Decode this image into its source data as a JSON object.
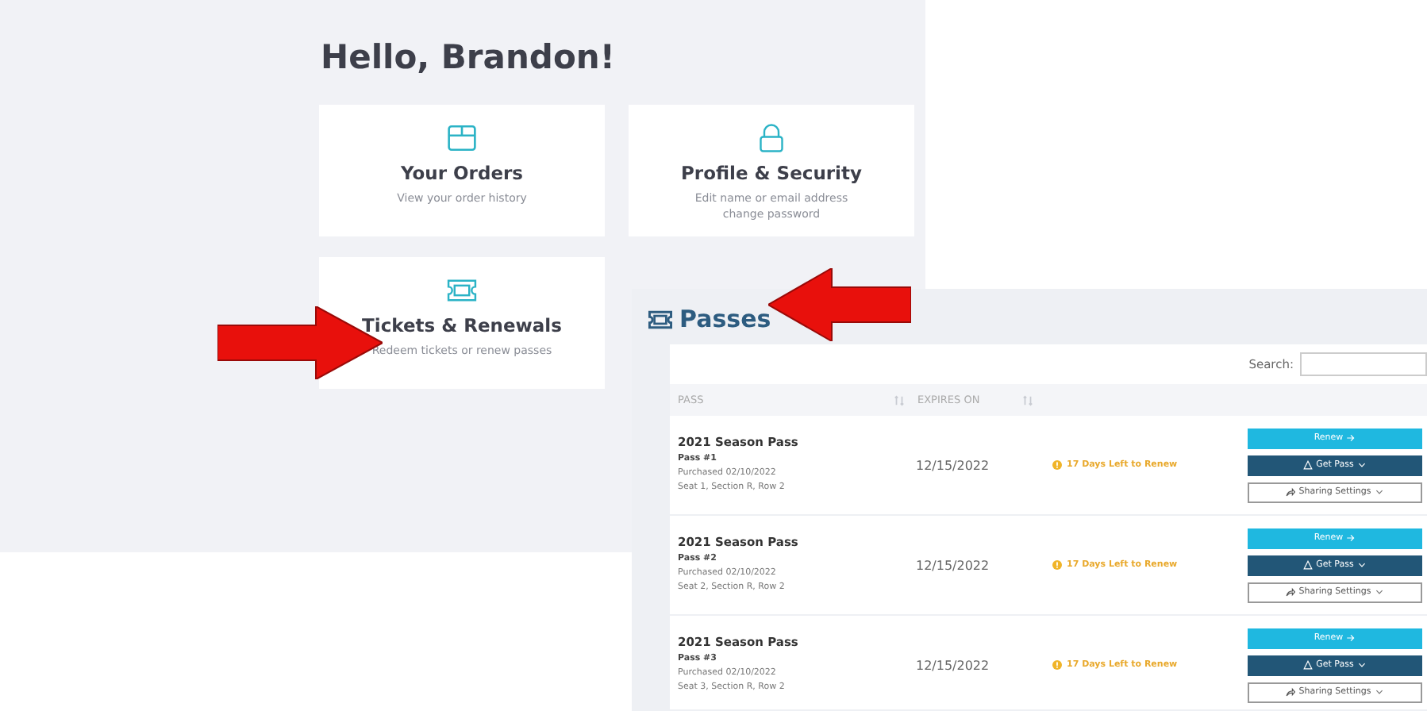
{
  "greeting": "Hello, Brandon!",
  "cards": [
    {
      "kind": "orders",
      "title": "Your Orders",
      "lines": [
        "View your order history"
      ]
    },
    {
      "kind": "security",
      "title": "Profile & Security",
      "lines": [
        "Edit name or email address",
        "change password"
      ]
    },
    {
      "kind": "tickets",
      "title": "Tickets & Renewals",
      "lines": [
        "Redeem tickets or renew passes"
      ]
    }
  ],
  "passes": {
    "title": "Passes",
    "search_label": "Search:",
    "columns": [
      "PASS",
      "EXPIRES ON"
    ],
    "rows": [
      {
        "name": "2021 Season Pass",
        "pass": "Pass #1",
        "purchased": "Purchased 02/10/2022",
        "seat": "Seat 1, Section R, Row 2",
        "expires": "12/15/2022",
        "status": "17 Days Left to Renew",
        "buttons": [
          {
            "kind": "renew",
            "label": "Renew"
          },
          {
            "kind": "get",
            "label": "Get Pass"
          },
          {
            "kind": "share",
            "label": "Sharing Settings"
          }
        ]
      },
      {
        "name": "2021 Season Pass",
        "pass": "Pass #2",
        "purchased": "Purchased 02/10/2022",
        "seat": "Seat 2, Section R, Row 2",
        "expires": "12/15/2022",
        "status": "17 Days Left to Renew",
        "buttons": [
          {
            "kind": "renew",
            "label": "Renew"
          },
          {
            "kind": "get",
            "label": "Get Pass"
          },
          {
            "kind": "share",
            "label": "Sharing Settings"
          }
        ]
      },
      {
        "name": "2021 Season Pass",
        "pass": "Pass #3",
        "purchased": "Purchased 02/10/2022",
        "seat": "Seat 3, Section R, Row 2",
        "expires": "12/15/2022",
        "status": "17 Days Left to Renew",
        "buttons": [
          {
            "kind": "renew",
            "label": "Renew"
          },
          {
            "kind": "get",
            "label": "Get Pass"
          },
          {
            "kind": "share",
            "label": "Sharing Settings"
          }
        ]
      }
    ]
  }
}
